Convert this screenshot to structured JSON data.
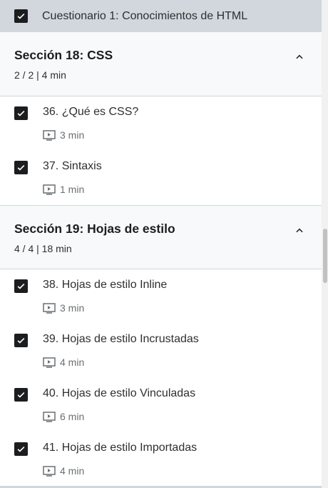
{
  "quiz": {
    "title": "Cuestionario 1: Conocimientos de HTML",
    "checked": true
  },
  "sections": [
    {
      "title": "Sección 18: CSS",
      "meta": "2 / 2 | 4 min",
      "items": [
        {
          "title": "36. ¿Qué es CSS?",
          "duration": "3 min",
          "checked": true,
          "icon": "video-icon"
        },
        {
          "title": "37. Sintaxis",
          "duration": "1 min",
          "checked": true,
          "icon": "video-icon"
        }
      ]
    },
    {
      "title": "Sección 19: Hojas de estilo",
      "meta": "4 / 4 | 18 min",
      "items": [
        {
          "title": "38. Hojas de estilo Inline",
          "duration": "3 min",
          "checked": true,
          "icon": "video-icon"
        },
        {
          "title": "39. Hojas de estilo Incrustadas",
          "duration": "4 min",
          "checked": true,
          "icon": "video-icon"
        },
        {
          "title": "40. Hojas de estilo Vinculadas",
          "duration": "6 min",
          "checked": true,
          "icon": "video-icon"
        },
        {
          "title": "41. Hojas de estilo Importadas",
          "duration": "4 min",
          "checked": true,
          "icon": "video-icon"
        }
      ]
    }
  ],
  "colors": {
    "header_bg": "#f7f9fa",
    "quiz_bg": "#d1d7dc",
    "checkbox": "#1c1d1f",
    "meta_text": "#6a6f73"
  }
}
